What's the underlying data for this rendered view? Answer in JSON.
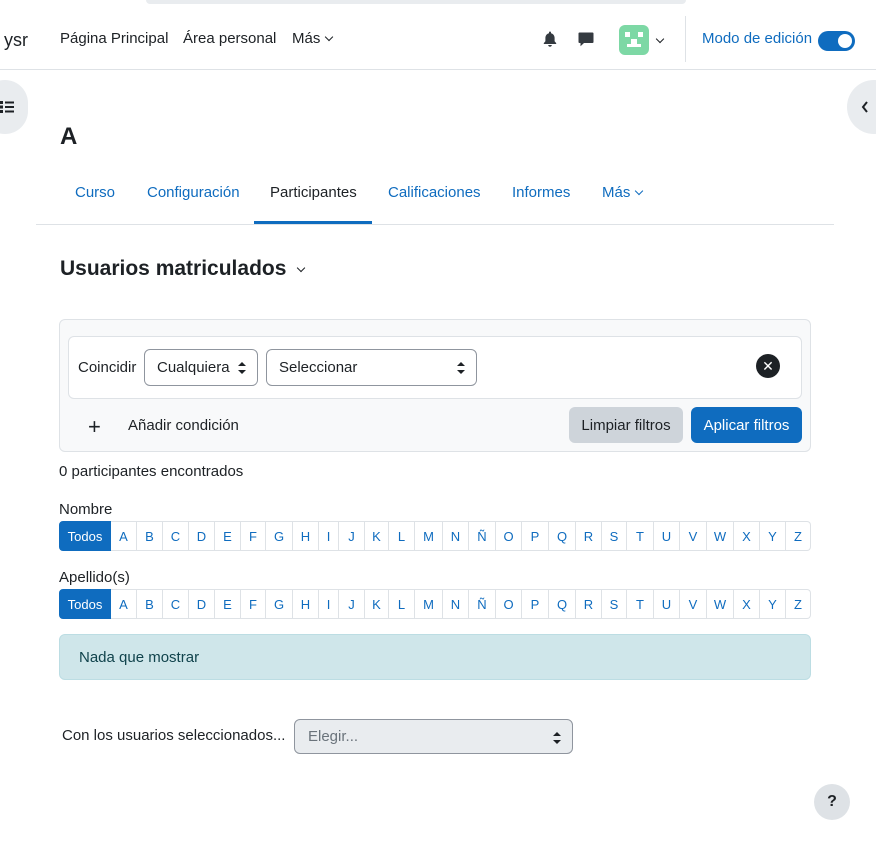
{
  "navbar": {
    "brand": "ysr",
    "links": [
      "Página Principal",
      "Área personal",
      "Más"
    ],
    "notifications_icon": "bell-icon",
    "messages_icon": "chat-icon",
    "edit_mode_label": "Modo de edición",
    "edit_mode_on": true
  },
  "course": {
    "title": "A"
  },
  "tabs": {
    "items": [
      "Curso",
      "Configuración",
      "Participantes",
      "Calificaciones",
      "Informes",
      "Más"
    ],
    "active": "Participantes"
  },
  "page": {
    "title": "Usuarios matriculados"
  },
  "filters": {
    "match_label": "Coincidir",
    "match_value": "Cualquiera",
    "type_placeholder": "Seleccionar",
    "add_condition_label": "Añadir condición",
    "clear_label": "Limpiar filtros",
    "apply_label": "Aplicar filtros"
  },
  "result_count": "0 participantes encontrados",
  "initials": {
    "firstname_label": "Nombre",
    "lastname_label": "Apellido(s)",
    "all_label": "Todos",
    "letters": [
      "A",
      "B",
      "C",
      "D",
      "E",
      "F",
      "G",
      "H",
      "I",
      "J",
      "K",
      "L",
      "M",
      "N",
      "Ñ",
      "O",
      "P",
      "Q",
      "R",
      "S",
      "T",
      "U",
      "V",
      "W",
      "X",
      "Y",
      "Z"
    ]
  },
  "empty_message": "Nada que mostrar",
  "bulk": {
    "label": "Con los usuarios seleccionados...",
    "placeholder": "Elegir..."
  },
  "help": "?",
  "colors": {
    "primary": "#0f6cbf",
    "alert_bg": "#cfe6ea",
    "avatar": "#7dd8a5"
  }
}
